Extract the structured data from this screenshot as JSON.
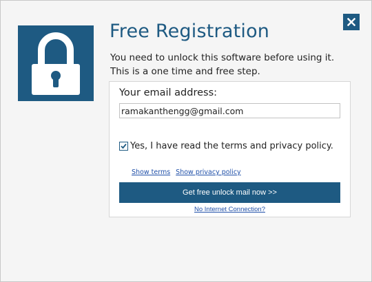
{
  "dialog": {
    "title": "Free Registration",
    "subtitle": "You need to unlock this software before using it. This is a one time and free step.",
    "close_icon": "close-icon",
    "lock_icon": "padlock-icon",
    "accent_color": "#1e5a82"
  },
  "form": {
    "email_label": "Your email address:",
    "email_value": "ramakanthengg@gmail.com",
    "terms_checked": true,
    "terms_label": "Yes, I have read the terms and privacy policy.",
    "show_terms_link": "Show terms",
    "show_privacy_link": "Show privacy policy",
    "submit_label": "Get free unlock mail now >>",
    "no_connection_link": "No Internet Connection?"
  }
}
